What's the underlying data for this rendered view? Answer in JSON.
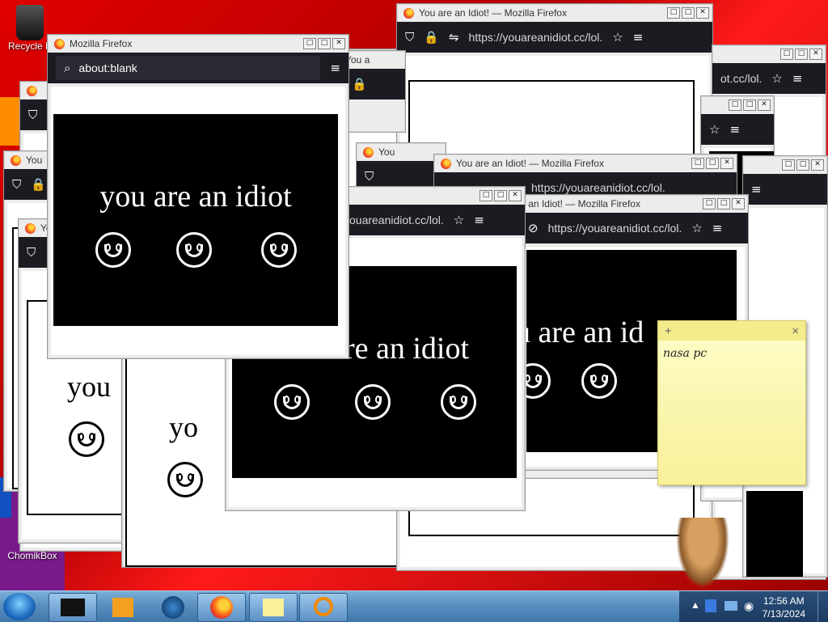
{
  "desktop": {
    "icons": [
      {
        "label": "Recycle B"
      },
      {
        "label": "ChomikBox"
      }
    ]
  },
  "browser": {
    "title_idiot": "You are an Idiot! — Mozilla Firefox",
    "title_blank": "Mozilla Firefox",
    "title_short": "You",
    "title_short2": "You a",
    "url": "https://youareanidiot.cc/lol.",
    "url_short": "youareanidiot.cc/lol.",
    "url_frag": "ot.cc/lol.",
    "url_blank": "about:blank",
    "minimize": "□",
    "maximize": "□",
    "close": "✕"
  },
  "page": {
    "message": "you are an idiot",
    "message_partial_1": "re an idiot",
    "message_partial_2": "u are an id",
    "message_partial_3": "you",
    "message_partial_4": "yo"
  },
  "sticky_note": {
    "add": "+",
    "close": "×",
    "text": "nasa pc"
  },
  "taskbar": {
    "time": "12:56 AM",
    "date": "7/13/2024"
  },
  "colors": {
    "desktop": "#c40000",
    "firefox_toolbar": "#1c1b22",
    "sticky": "#fdfdc8",
    "taskbar": "#5a8fc0"
  }
}
